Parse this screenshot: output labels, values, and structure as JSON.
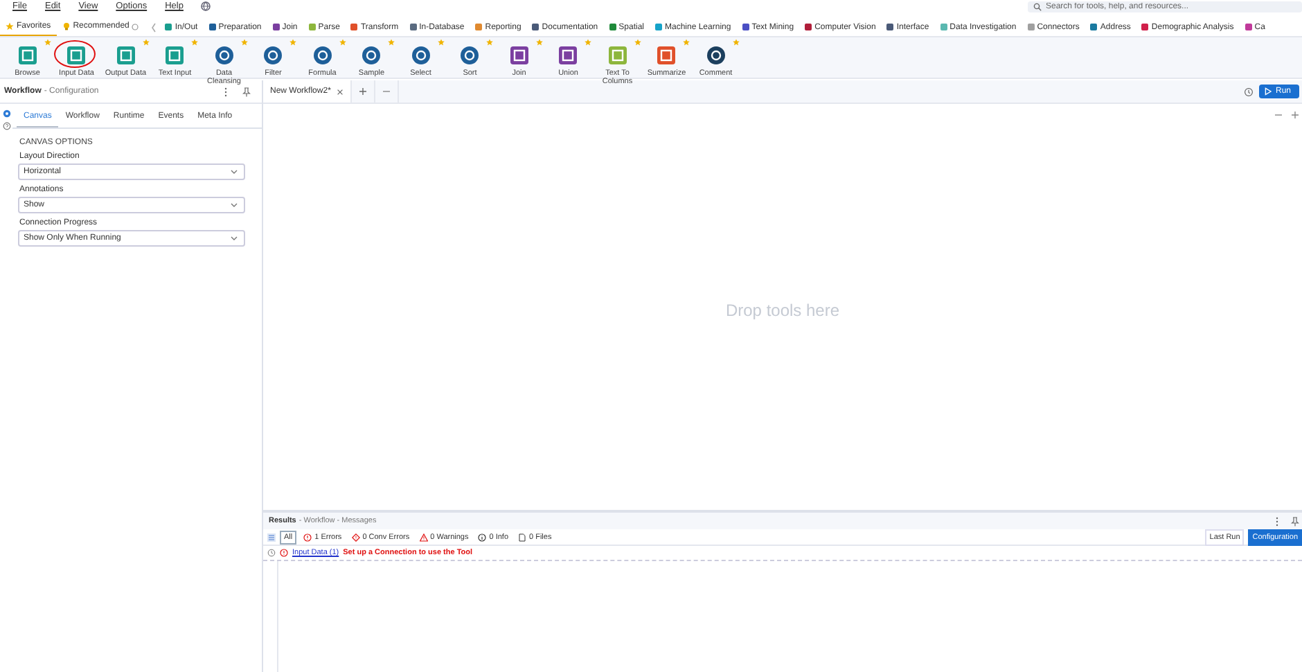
{
  "menu": [
    "File",
    "Edit",
    "View",
    "Options",
    "Help"
  ],
  "search": {
    "placeholder": "Search for tools, help, and resources..."
  },
  "palette_tabs": [
    {
      "label": "Favorites",
      "selected": true
    },
    {
      "label": "Recommended",
      "selected": false
    }
  ],
  "categories": [
    {
      "label": "In/Out",
      "color": "#1a9e8f"
    },
    {
      "label": "Preparation",
      "color": "#1e5f99"
    },
    {
      "label": "Join",
      "color": "#7b3fa0"
    },
    {
      "label": "Parse",
      "color": "#8db63c"
    },
    {
      "label": "Transform",
      "color": "#e0502a"
    },
    {
      "label": "In-Database",
      "color": "#5a6b80"
    },
    {
      "label": "Reporting",
      "color": "#e08a30"
    },
    {
      "label": "Documentation",
      "color": "#4a5a78"
    },
    {
      "label": "Spatial",
      "color": "#1f8a3a"
    },
    {
      "label": "Machine Learning",
      "color": "#16a3c9"
    },
    {
      "label": "Text Mining",
      "color": "#4b4fc4"
    },
    {
      "label": "Computer Vision",
      "color": "#b01e3a"
    },
    {
      "label": "Interface",
      "color": "#4a5a78"
    },
    {
      "label": "Data Investigation",
      "color": "#5ab8b0"
    },
    {
      "label": "Connectors",
      "color": "#a0a0a0"
    },
    {
      "label": "Address",
      "color": "#1a7aa0"
    },
    {
      "label": "Demographic Analysis",
      "color": "#d0204a"
    },
    {
      "label": "Ca",
      "color": "#c03a9a"
    }
  ],
  "tools": [
    {
      "label": "Browse",
      "kind": "square",
      "color": "#1a9e8f",
      "favorite": true,
      "highlighted": false
    },
    {
      "label": "Input Data",
      "kind": "square",
      "color": "#1a9e8f",
      "favorite": false,
      "highlighted": true
    },
    {
      "label": "Output Data",
      "kind": "square",
      "color": "#1a9e8f",
      "favorite": true,
      "highlighted": false
    },
    {
      "label": "Text Input",
      "kind": "square",
      "color": "#1a9e8f",
      "favorite": true,
      "highlighted": false
    },
    {
      "label": "Data Cleansing",
      "kind": "circle",
      "color": "#1e5f99",
      "favorite": true,
      "highlighted": false
    },
    {
      "label": "Filter",
      "kind": "circle",
      "color": "#1e5f99",
      "favorite": true,
      "highlighted": false
    },
    {
      "label": "Formula",
      "kind": "circle",
      "color": "#1e5f99",
      "favorite": true,
      "highlighted": false
    },
    {
      "label": "Sample",
      "kind": "circle",
      "color": "#1e5f99",
      "favorite": true,
      "highlighted": false
    },
    {
      "label": "Select",
      "kind": "circle",
      "color": "#1e5f99",
      "favorite": true,
      "highlighted": false
    },
    {
      "label": "Sort",
      "kind": "circle",
      "color": "#1e5f99",
      "favorite": true,
      "highlighted": false
    },
    {
      "label": "Join",
      "kind": "square",
      "color": "#7b3fa0",
      "favorite": true,
      "highlighted": false
    },
    {
      "label": "Union",
      "kind": "square",
      "color": "#7b3fa0",
      "favorite": true,
      "highlighted": false
    },
    {
      "label": "Text To Columns",
      "kind": "square",
      "color": "#8db63c",
      "favorite": true,
      "highlighted": false
    },
    {
      "label": "Summarize",
      "kind": "square",
      "color": "#e0502a",
      "favorite": true,
      "highlighted": false
    },
    {
      "label": "Comment",
      "kind": "circle",
      "color": "#1c3f5e",
      "favorite": true,
      "highlighted": false
    }
  ],
  "config": {
    "title": "Workflow",
    "subtitle": "- Configuration",
    "tabs": [
      {
        "label": "Canvas",
        "selected": true
      },
      {
        "label": "Workflow",
        "selected": false
      },
      {
        "label": "Runtime",
        "selected": false
      },
      {
        "label": "Events",
        "selected": false
      },
      {
        "label": "Meta Info",
        "selected": false
      }
    ],
    "section": "CANVAS OPTIONS",
    "fields": [
      {
        "label": "Layout Direction",
        "value": "Horizontal"
      },
      {
        "label": "Annotations",
        "value": "Show"
      },
      {
        "label": "Connection Progress",
        "value": "Show Only When Running"
      }
    ]
  },
  "canvas": {
    "tab": "New Workflow2*",
    "placeholder": "Drop tools here",
    "run": "Run"
  },
  "results": {
    "title": "Results",
    "crumbs": "- Workflow - Messages",
    "filters": [
      {
        "kind": "all",
        "label": "All",
        "selected": true
      },
      {
        "kind": "error",
        "label": "1 Errors",
        "selected": false
      },
      {
        "kind": "conv",
        "label": "0 Conv Errors",
        "selected": false
      },
      {
        "kind": "warning",
        "label": "0 Warnings",
        "selected": false
      },
      {
        "kind": "info",
        "label": "0 Info",
        "selected": false
      },
      {
        "kind": "file",
        "label": "0 Files",
        "selected": false
      }
    ],
    "views": [
      {
        "label": "Last Run",
        "selected": false
      },
      {
        "label": "Configuration",
        "selected": true
      }
    ],
    "messages": [
      {
        "link": "Input Data (1)",
        "text": "Set up a Connection to use the Tool"
      }
    ]
  }
}
